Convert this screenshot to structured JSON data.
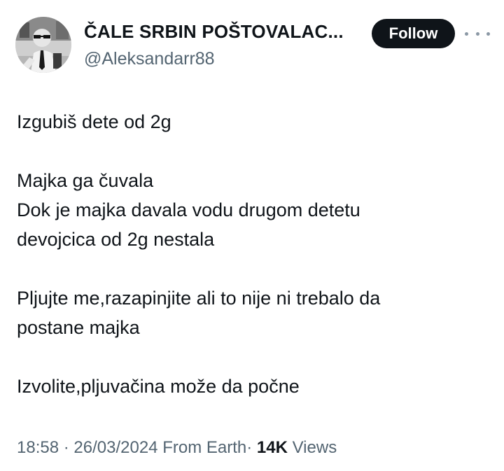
{
  "header": {
    "display_name": "ČALE SRBIN POŠTOVALAC...",
    "handle": "@Aleksandarr88",
    "follow_label": "Follow",
    "avatar_icon": "profile-photo-icon",
    "more_icon": "more-horizontal-icon"
  },
  "tweet": {
    "lines": [
      "Izgubiš dete od 2g",
      "Majka ga čuvala",
      "Dok je majka davala vodu drugom detetu",
      "devojcica od 2g nestala",
      "Pljujte me,razapinjite ali to nije ni trebalo da",
      "postane majka",
      "Izvolite,pljuvačina može da počne"
    ]
  },
  "meta": {
    "time": "18:58",
    "date": "26/03/2024",
    "source": "From Earth",
    "separator": "·",
    "views_count": "14K",
    "views_label": "Views"
  },
  "colors": {
    "text_primary": "#0f1419",
    "text_secondary": "#536471",
    "follow_bg": "#0f1419",
    "follow_text": "#ffffff"
  }
}
